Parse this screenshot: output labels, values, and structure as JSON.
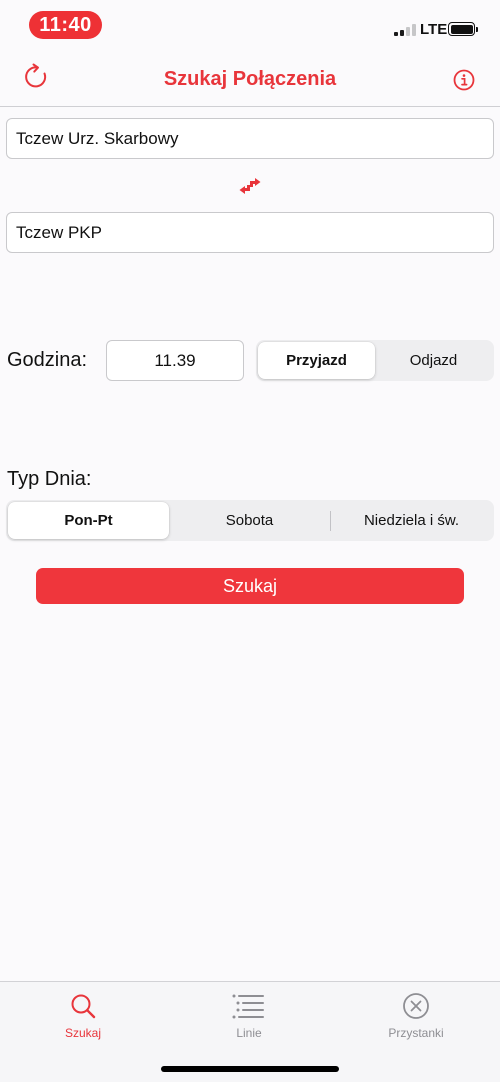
{
  "status_bar": {
    "time": "11:40",
    "network": "LTE",
    "accent_color": "#ee3135"
  },
  "nav": {
    "title": "Szukaj Połączenia",
    "refresh_icon": "refresh-icon",
    "info_icon": "info-icon"
  },
  "form": {
    "from_value": "Tczew Urz. Skarbowy",
    "to_value": "Tczew PKP",
    "swap_icon": "swap-arrows-icon",
    "time_label": "Godzina:",
    "time_value": "11.39",
    "time_mode": {
      "options": [
        "Przyjazd",
        "Odjazd"
      ],
      "selected": "Przyjazd"
    },
    "day_type_label": "Typ Dnia:",
    "day_type": {
      "options": [
        "Pon-Pt",
        "Sobota",
        "Niedziela i św."
      ],
      "selected": "Pon-Pt"
    },
    "search_button": "Szukaj"
  },
  "tab_bar": {
    "tabs": [
      {
        "label": "Szukaj",
        "icon": "search-icon",
        "active": true
      },
      {
        "label": "Linie",
        "icon": "list-icon",
        "active": false
      },
      {
        "label": "Przystanki",
        "icon": "close-circle-icon",
        "active": false
      }
    ]
  },
  "colors": {
    "accent": "#e8353b",
    "button": "#ef363c",
    "inactive": "#8e8e93"
  }
}
